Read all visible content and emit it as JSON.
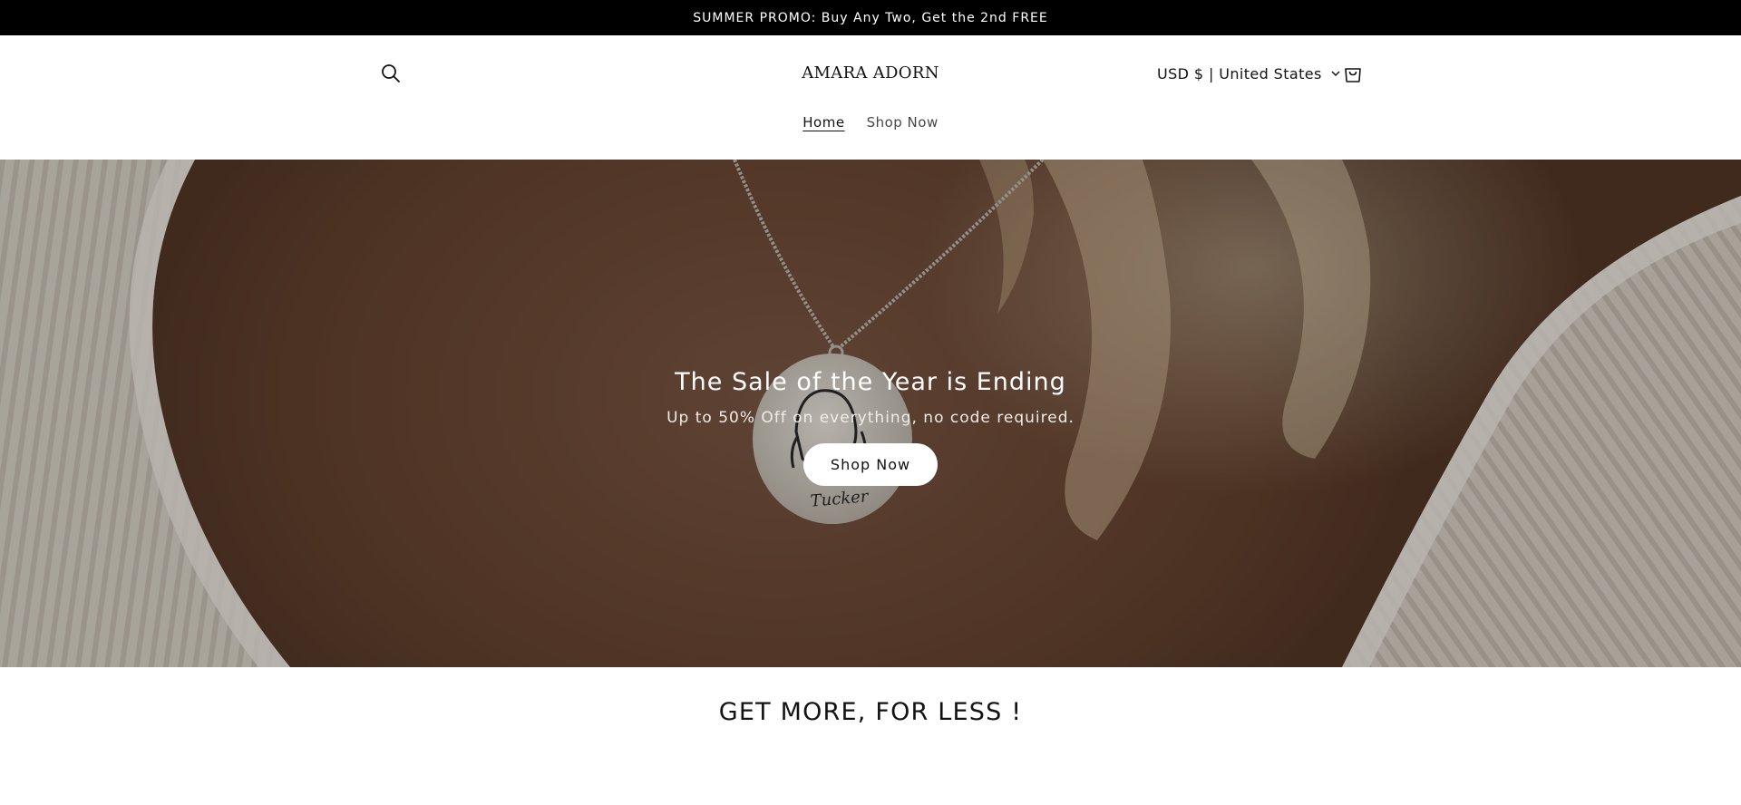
{
  "announcement": {
    "text": "SUMMER PROMO: Buy Any Two, Get the 2nd FREE"
  },
  "header": {
    "search_icon": "search-icon",
    "logo": "AMARA ADORN",
    "locale": "USD $ | United States",
    "locale_icon": "chevron-down-icon",
    "cart_icon": "cart-icon"
  },
  "nav": {
    "items": [
      {
        "label": "Home",
        "active": true
      },
      {
        "label": "Shop Now",
        "active": false
      }
    ]
  },
  "hero": {
    "title": "The Sale of the Year is Ending",
    "subtitle": "Up to 50% Off on everything, no code required.",
    "button": "Shop Now",
    "pendant_text": "Tucker"
  },
  "section": {
    "title": "GET MORE, FOR LESS !"
  },
  "colors": {
    "announcement_bg": "#000000",
    "hero_skin": "#6b4734",
    "button_bg": "#ffffff"
  }
}
